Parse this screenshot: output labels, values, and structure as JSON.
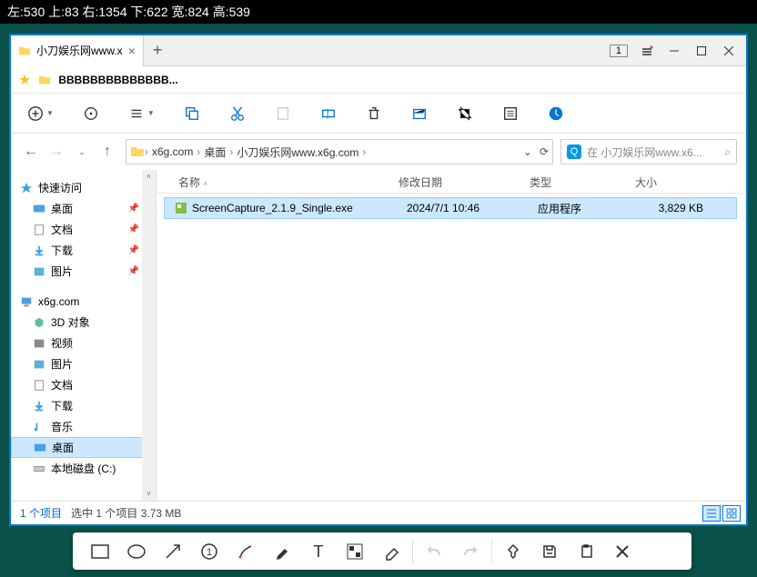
{
  "coords_text": "左:530  上:83  右:1354  下:622  宽:824  高:539",
  "tab": {
    "title": "小刀娱乐网www.x"
  },
  "window_badge": "1",
  "bookmarks_item": "BBBBBBBBBBBBBB...",
  "breadcrumb": {
    "items": [
      "x6g.com",
      "桌面",
      "小刀娱乐网www.x6g.com"
    ]
  },
  "search_placeholder": "在 小刀娱乐网www.x6...",
  "sidebar": {
    "quick_access": "快速访问",
    "desktop": "桌面",
    "documents": "文档",
    "downloads": "下载",
    "pictures": "图片",
    "pc": "x6g.com",
    "3d": "3D 对象",
    "videos": "视频",
    "pictures2": "图片",
    "documents2": "文档",
    "downloads2": "下载",
    "music": "音乐",
    "desktop2": "桌面",
    "local_disk": "本地磁盘 (C:)"
  },
  "columns": {
    "name": "名称",
    "date": "修改日期",
    "type": "类型",
    "size": "大小"
  },
  "file": {
    "name": "ScreenCapture_2.1.9_Single.exe",
    "date": "2024/7/1 10:46",
    "type": "应用程序",
    "size": "3,829 KB"
  },
  "status": {
    "items": "1 个项目",
    "selected": "选中 1 个项目  3.73 MB"
  }
}
